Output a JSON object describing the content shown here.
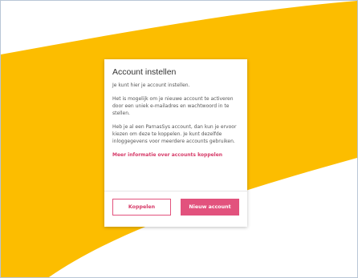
{
  "colors": {
    "background_wave": "#fcbd00",
    "background": "#ffffff",
    "accent": "#e2527d",
    "link": "#d63a68",
    "frame_border": "#b9c6d6"
  },
  "dialog": {
    "title": "Account instellen",
    "intro": "Je kunt hier je account instellen.",
    "paragraph1": "Het is mogelijk om je nieuwe account te activeren door een uniek e-mailadres en wachtwoord in te stellen.",
    "paragraph2": "Heb je al een ParnasSys account, dan kun je ervoor kiezen om deze te koppelen. Je kunt dezelfde inloggegevens voor meerdere accounts gebruiken.",
    "more_info_link": "Meer informatie over accounts koppelen",
    "buttons": {
      "link_account": "Koppelen",
      "new_account": "Nieuw account"
    }
  }
}
